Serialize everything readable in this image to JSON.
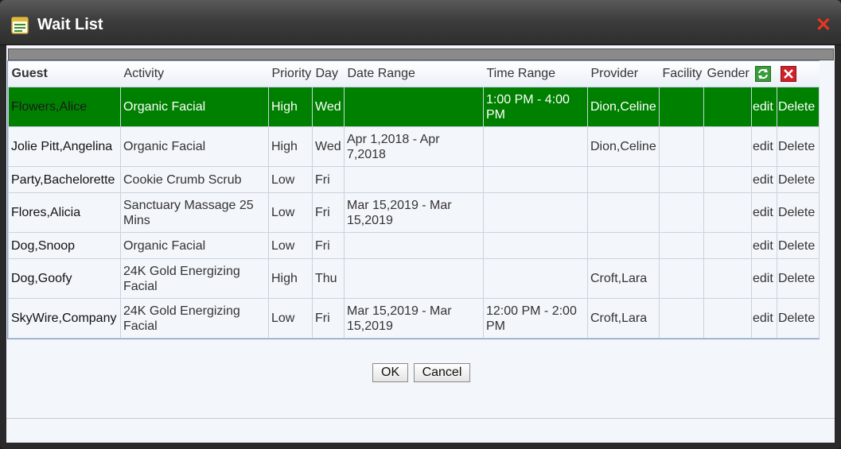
{
  "window": {
    "title": "Wait List",
    "close_icon": "close-icon"
  },
  "table": {
    "headers": [
      "Guest",
      "Activity",
      "Priority",
      "Day",
      "Date Range",
      "Time Range",
      "Provider",
      "Facility",
      "Gender"
    ],
    "rows": [
      {
        "guest": "Flowers,Alice",
        "activity": "Organic Facial",
        "priority": "High",
        "day": "Wed",
        "date_range": "",
        "time_range": "1:00 PM - 4:00 PM",
        "provider": "Dion,Celine",
        "facility": "",
        "gender": "",
        "edit": "edit",
        "delete": "Delete"
      },
      {
        "guest": "Jolie Pitt,Angelina",
        "activity": "Organic Facial",
        "priority": "High",
        "day": "Wed",
        "date_range": "Apr 1,2018 - Apr 7,2018",
        "time_range": "",
        "provider": "Dion,Celine",
        "facility": "",
        "gender": "",
        "edit": "edit",
        "delete": "Delete"
      },
      {
        "guest": "Party,Bachelorette",
        "activity": "Cookie Crumb Scrub",
        "priority": "Low",
        "day": "Fri",
        "date_range": "",
        "time_range": "",
        "provider": "",
        "facility": "",
        "gender": "",
        "edit": "edit",
        "delete": "Delete"
      },
      {
        "guest": "Flores,Alicia",
        "activity": "Sanctuary Massage 25 Mins",
        "priority": "Low",
        "day": "Fri",
        "date_range": "Mar 15,2019 - Mar 15,2019",
        "time_range": "",
        "provider": "",
        "facility": "",
        "gender": "",
        "edit": "edit",
        "delete": "Delete"
      },
      {
        "guest": "Dog,Snoop",
        "activity": "Organic Facial",
        "priority": "Low",
        "day": "Fri",
        "date_range": "",
        "time_range": "",
        "provider": "",
        "facility": "",
        "gender": "",
        "edit": "edit",
        "delete": "Delete"
      },
      {
        "guest": "Dog,Goofy",
        "activity": "24K Gold Energizing Facial",
        "priority": "High",
        "day": "Thu",
        "date_range": "",
        "time_range": "",
        "provider": "Croft,Lara",
        "facility": "",
        "gender": "",
        "edit": "edit",
        "delete": "Delete"
      },
      {
        "guest": "SkyWire,Company",
        "activity": "24K Gold Energizing Facial",
        "priority": "Low",
        "day": "Fri",
        "date_range": "Mar 15,2019 - Mar 15,2019",
        "time_range": "12:00 PM - 2:00 PM",
        "provider": "Croft,Lara",
        "facility": "",
        "gender": "",
        "edit": "edit",
        "delete": "Delete"
      }
    ]
  },
  "buttons": {
    "ok": "OK",
    "cancel": "Cancel"
  },
  "colors": {
    "selected_row": "#008000",
    "close": "#e8361d",
    "refresh": "#3a9b3a",
    "remove": "#d0202a"
  }
}
